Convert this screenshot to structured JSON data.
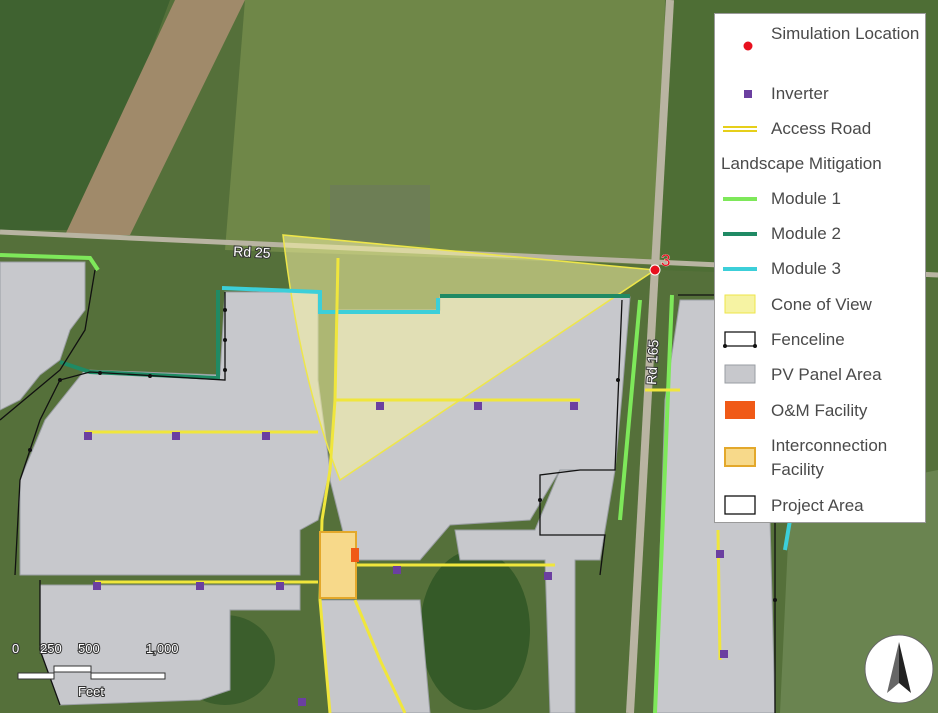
{
  "roads": {
    "rd25": "Rd 25",
    "rd165": "Rd 165"
  },
  "simulation_point_label": "3",
  "legend": {
    "items": [
      {
        "label": "Simulation Location",
        "symbol": "red-dot"
      },
      {
        "label": "Inverter",
        "symbol": "purple-square"
      },
      {
        "label": "Access Road",
        "symbol": "yellow-double-line"
      },
      {
        "label": "Landscape Mitigation",
        "symbol": "heading"
      },
      {
        "label": "Module 1",
        "symbol": "line",
        "color": "#7ee85a"
      },
      {
        "label": "Module 2",
        "symbol": "line",
        "color": "#1f8a64"
      },
      {
        "label": "Module 3",
        "symbol": "line",
        "color": "#3ccfd9"
      },
      {
        "label": "Cone of View",
        "symbol": "fill",
        "color": "#f6f3a3"
      },
      {
        "label": "Fenceline",
        "symbol": "fence"
      },
      {
        "label": "PV Panel Area",
        "symbol": "fill",
        "color": "#c7c8cc"
      },
      {
        "label": "O&M Facility",
        "symbol": "fill",
        "color": "#f05a17"
      },
      {
        "label": "Interconnection Facility",
        "symbol": "fill",
        "color": "#f7d98a"
      },
      {
        "label": "Project Area",
        "symbol": "outline"
      }
    ]
  },
  "scalebar": {
    "ticks": [
      "0",
      "250",
      "500",
      "1,000"
    ],
    "unit": "Feet"
  },
  "north_arrow": "N",
  "colors": {
    "simulation": "#e8101e",
    "inverter": "#6b3fa0",
    "access_road": "#f0e63c",
    "module1": "#7ee85a",
    "module2": "#1f8a64",
    "module3": "#3ccfd9",
    "cone": "#f6f3a3",
    "pv": "#c7c8cc",
    "om": "#f05a17",
    "interconnection": "#f7d98a"
  }
}
